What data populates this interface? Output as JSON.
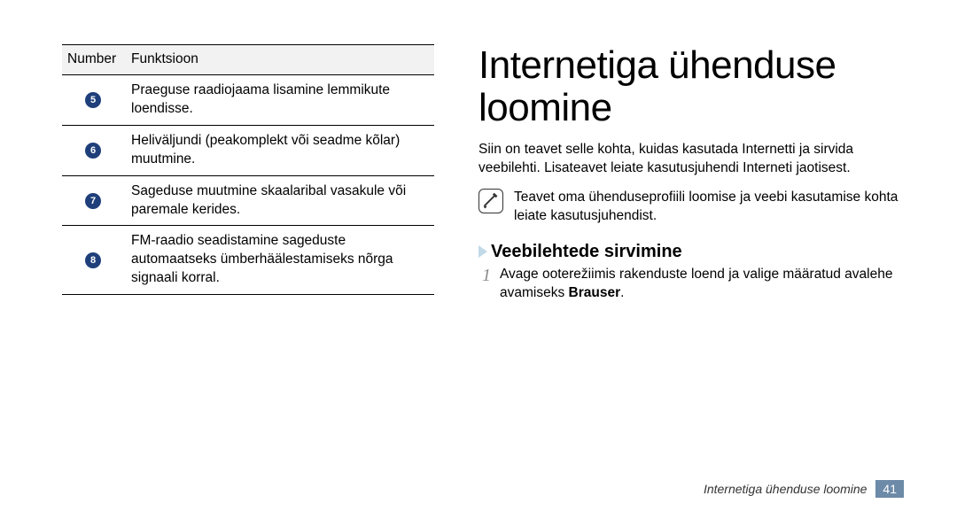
{
  "table": {
    "head": {
      "col1": "Number",
      "col2": "Funktsioon"
    },
    "rows": [
      {
        "num": "5",
        "text": "Praeguse raadiojaama lisamine lemmikute loendisse."
      },
      {
        "num": "6",
        "text": "Heliväljundi (peakomplekt või seadme kõlar) muutmine."
      },
      {
        "num": "7",
        "text": "Sageduse muutmine skaalaribal vasakule või paremale kerides."
      },
      {
        "num": "8",
        "text": "FM-raadio seadistamine sageduste automaatseks ümberhäälestamiseks nõrga signaali korral."
      }
    ]
  },
  "heading": "Internetiga ühenduse loomine",
  "lead": "Siin on teavet selle kohta, kuidas kasutada Internetti ja sirvida veebilehti. Lisateavet leiate kasutusjuhendi Interneti jaotisest.",
  "note": "Teavet oma ühenduseprofiili loomise ja veebi kasutamise kohta leiate kasutusjuhendist.",
  "subhead": "Veebilehtede sirvimine",
  "step1": {
    "num": "1",
    "pre": "Avage ooterežiimis rakenduste loend ja valige määratud avalehe avamiseks ",
    "bold": "Brauser",
    "post": "."
  },
  "footer": {
    "section": "Internetiga ühenduse loomine",
    "page": "41"
  }
}
